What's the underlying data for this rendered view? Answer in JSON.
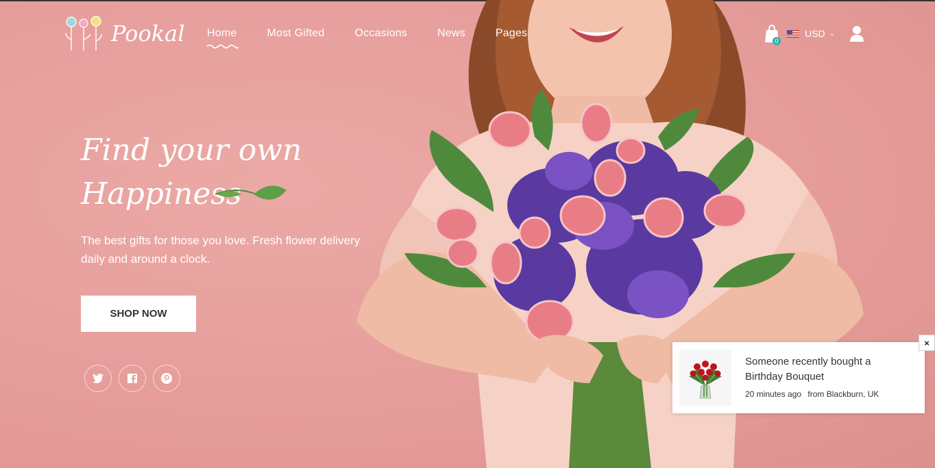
{
  "brand": {
    "name": "Pookal"
  },
  "nav": {
    "items": [
      {
        "label": "Home",
        "active": true
      },
      {
        "label": "Most Gifted"
      },
      {
        "label": "Occasions"
      },
      {
        "label": "News"
      },
      {
        "label": "Pages"
      }
    ]
  },
  "header": {
    "cart_count": "0",
    "currency": "USD"
  },
  "hero": {
    "headline_line1": "Find your own",
    "headline_line2": "Happiness",
    "subtitle": "The best gifts for those you love. Fresh flower delivery daily and around a clock.",
    "cta_label": "SHOP NOW"
  },
  "socials": [
    "twitter-icon",
    "facebook-icon",
    "pinterest-icon"
  ],
  "notification": {
    "title": "Someone recently bought a Birthday Bouquet",
    "time": "20 minutes ago",
    "location": "from Blackburn, UK",
    "close": "×"
  },
  "colors": {
    "background": "#e9a3a0",
    "accent_badge": "#2bb3a8",
    "button_bg": "#ffffff"
  }
}
